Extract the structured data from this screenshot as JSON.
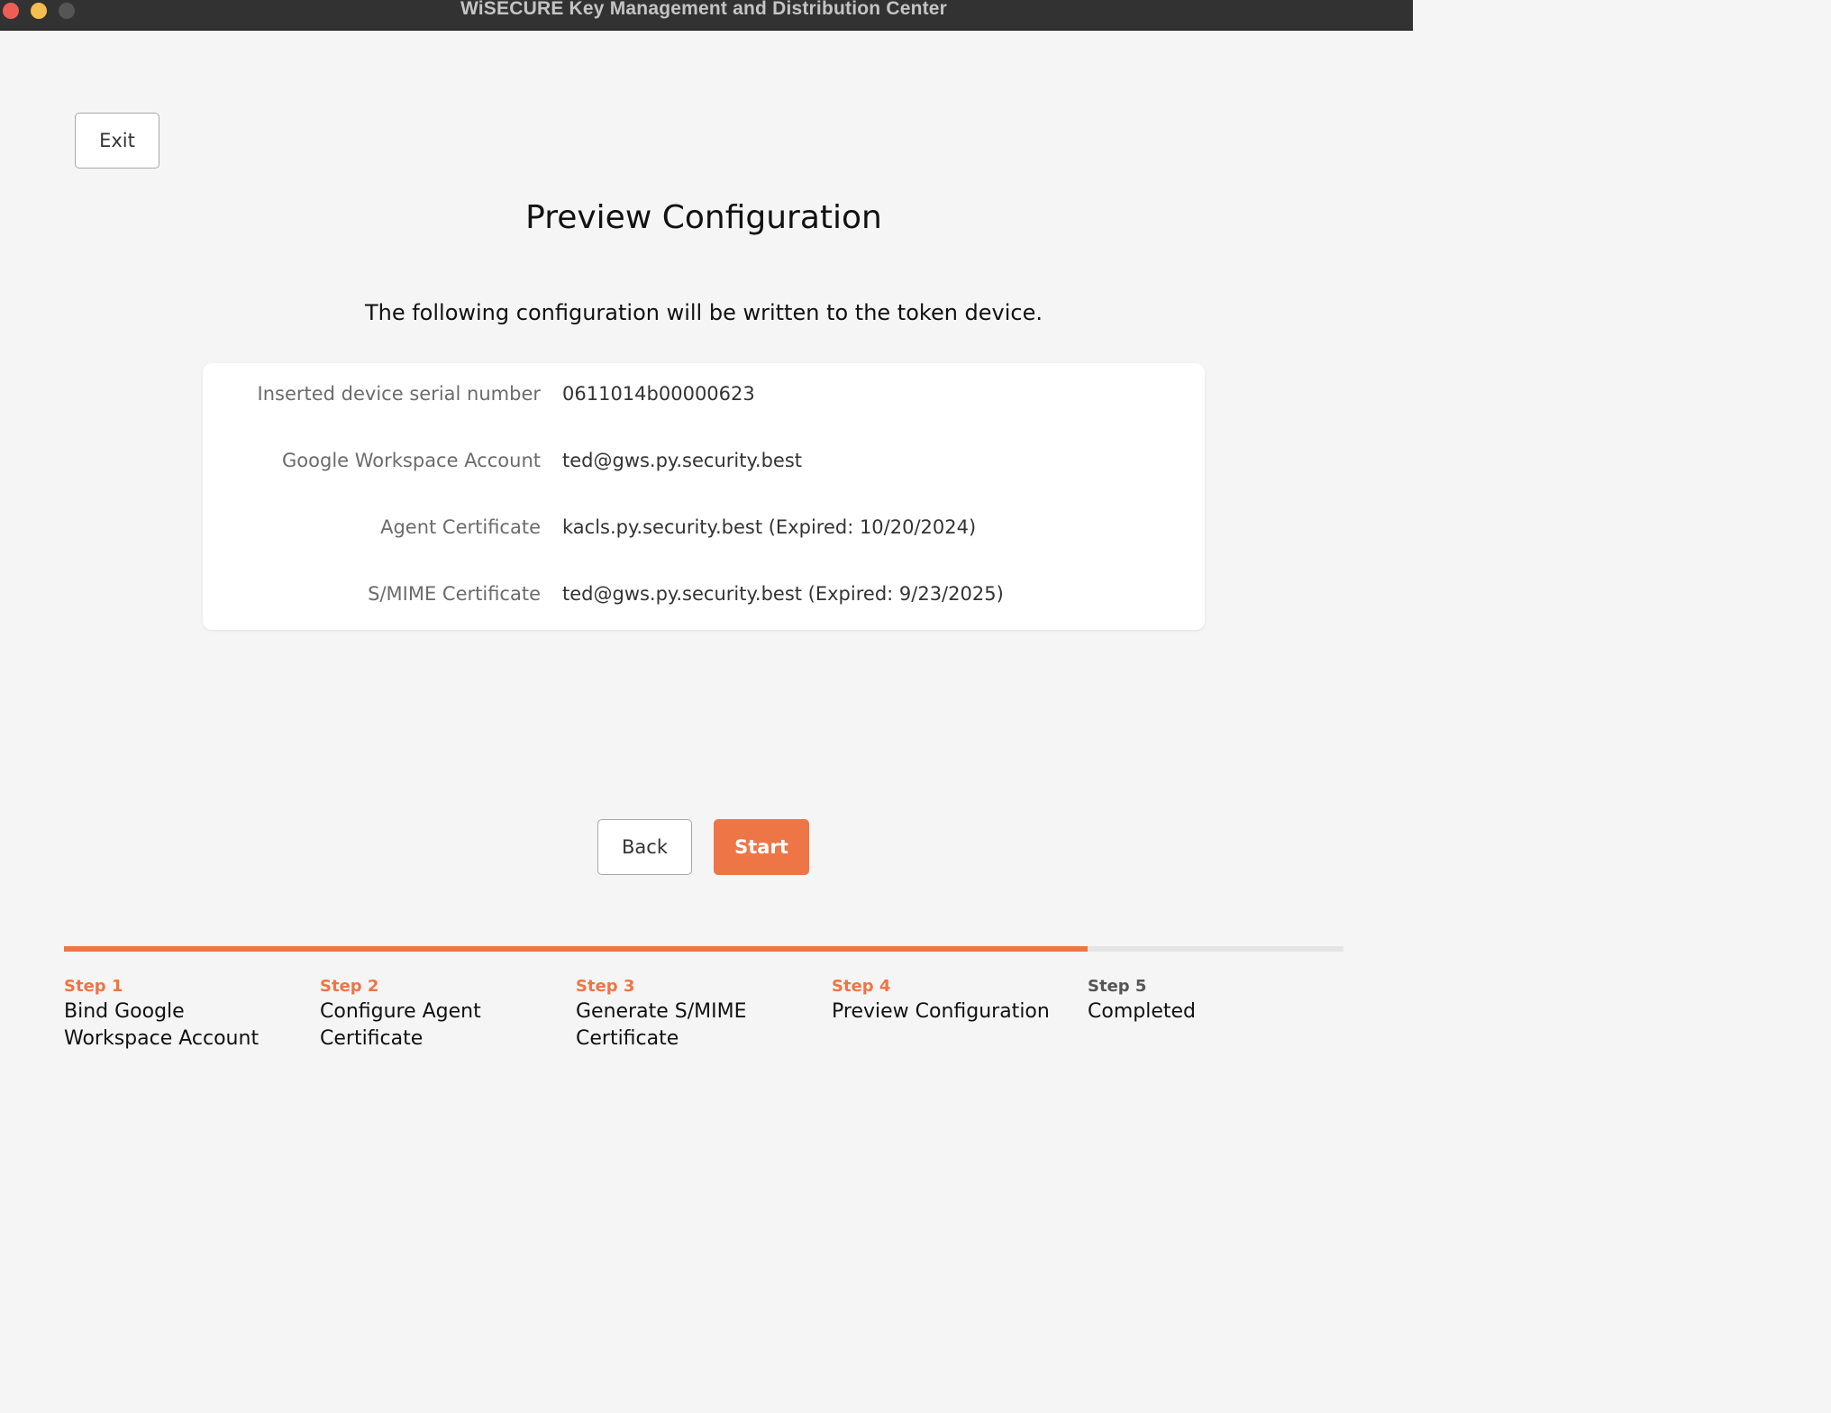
{
  "window": {
    "title": "WiSECURE Key Management and Distribution Center"
  },
  "toolbar": {
    "exit_label": "Exit"
  },
  "page": {
    "title": "Preview Configuration",
    "description": "The following configuration will be written to the token device."
  },
  "config": [
    {
      "label": "Inserted device serial number",
      "value": "0611014b00000623"
    },
    {
      "label": "Google Workspace Account",
      "value": "ted@gws.py.security.best"
    },
    {
      "label": "Agent Certificate",
      "value": "kacls.py.security.best (Expired: 10/20/2024)"
    },
    {
      "label": "S/MIME Certificate",
      "value": "ted@gws.py.security.best (Expired: 9/23/2025)"
    }
  ],
  "actions": {
    "back_label": "Back",
    "start_label": "Start"
  },
  "stepper": {
    "progress_fraction": 0.8,
    "active_color": "#ed7546",
    "steps": [
      {
        "number": "Step 1",
        "title_line1": "Bind Google",
        "title_line2": "Workspace Account",
        "state": "done"
      },
      {
        "number": "Step 2",
        "title_line1": "Configure Agent",
        "title_line2": "Certificate",
        "state": "done"
      },
      {
        "number": "Step 3",
        "title_line1": "Generate S/MIME",
        "title_line2": "Certificate",
        "state": "done"
      },
      {
        "number": "Step 4",
        "title_line1": "Preview Configuration",
        "title_line2": "",
        "state": "current"
      },
      {
        "number": "Step 5",
        "title_line1": "Completed",
        "title_line2": "",
        "state": "pending"
      }
    ]
  }
}
